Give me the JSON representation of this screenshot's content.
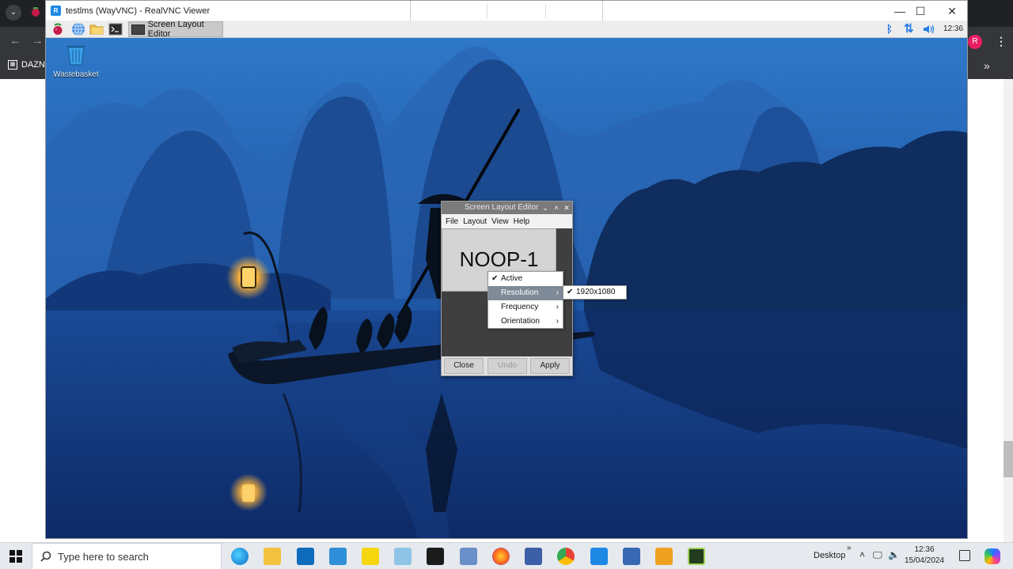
{
  "host_browser": {
    "bookmark": "DAZN",
    "profile_initial": "R"
  },
  "vnc_window": {
    "title": "testlms (WayVNC) - RealVNC Viewer",
    "logo_text": "R",
    "controls": [
      "—",
      "☐",
      "✕"
    ]
  },
  "remote_panel": {
    "taskbar_app": "Screen Layout Editor",
    "clock": "12:36"
  },
  "desktop": {
    "icons": [
      {
        "label": "Wastebasket"
      }
    ]
  },
  "screen_layout_editor": {
    "title": "Screen Layout Editor",
    "menu": [
      "File",
      "Layout",
      "View",
      "Help"
    ],
    "monitor_label": "NOOP-1",
    "buttons": {
      "close": "Close",
      "undo": "Undo",
      "apply": "Apply"
    }
  },
  "context_menu": {
    "items": [
      {
        "label": "Active",
        "checked": true,
        "submenu": false,
        "highlighted": false
      },
      {
        "label": "Resolution",
        "checked": false,
        "submenu": true,
        "highlighted": true
      },
      {
        "label": "Frequency",
        "checked": false,
        "submenu": true,
        "highlighted": false
      },
      {
        "label": "Orientation",
        "checked": false,
        "submenu": true,
        "highlighted": false
      }
    ],
    "submenu": {
      "label": "1920x1080",
      "checked": true
    }
  },
  "windows_taskbar": {
    "search_placeholder": "Type here to search",
    "desktop_label": "Desktop",
    "time": "12:36",
    "date": "15/04/2024"
  },
  "colors": {
    "sky_top": "#2f78c8",
    "water": "#12306f",
    "menu_highlight": "#7e8a97"
  }
}
